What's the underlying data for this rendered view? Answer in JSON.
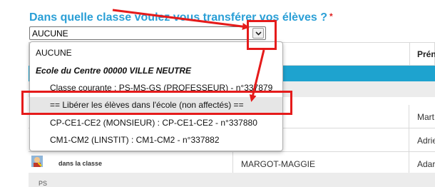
{
  "question": {
    "text": "Dans quelle classe voulez vous transférer vos élèves ?",
    "required_mark": "*"
  },
  "select": {
    "value": "AUCUNE"
  },
  "dropdown": {
    "options": [
      "AUCUNE",
      "Ecole du Centre 00000 VILLE NEUTRE",
      "Classe courante : PS-MS-GS (PROFESSEUR) - n°337879",
      "== Libérer les élèves dans l'école (non affectés) ==",
      "CP-CE1-CE2 (MONSIEUR) : CP-CE1-CE2 - n°337880",
      "CM1-CM2 (LINSTIT) : CM1-CM2 - n°337882"
    ],
    "highlighted_index": 3
  },
  "table": {
    "header_prenom": "Prén",
    "rows": [
      {
        "first": "Mart"
      },
      {
        "first": "Adrie"
      },
      {
        "status": "dans la classe",
        "lname": "MARGOT-MAGGIE",
        "first": "Adar"
      }
    ],
    "footer_text": "PS"
  },
  "colors": {
    "title": "#2a9fd6",
    "annotation": "#e51b1b",
    "blue_bar": "#1ea3cf"
  }
}
